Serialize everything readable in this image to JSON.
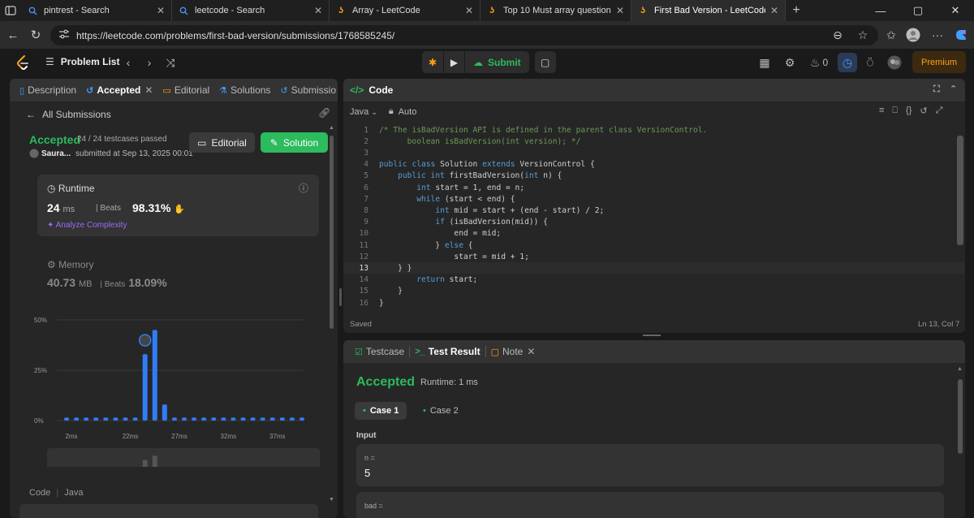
{
  "browser": {
    "tabs": [
      {
        "title": "pintrest - Search",
        "active": false
      },
      {
        "title": "leetcode - Search",
        "active": false
      },
      {
        "title": "Array - LeetCode",
        "active": false
      },
      {
        "title": "Top 10 Must array question for in",
        "active": false
      },
      {
        "title": "First Bad Version - LeetCode",
        "active": true
      }
    ],
    "url": "https://leetcode.com/problems/first-bad-version/submissions/1768585245/"
  },
  "header": {
    "problem_list": "Problem List",
    "submit": "Submit",
    "streak_count": "0",
    "premium": "Premium"
  },
  "left_panel": {
    "tabs": [
      "Description",
      "Accepted",
      "Editorial",
      "Solutions",
      "Submissio"
    ],
    "all_submissions": "All Submissions",
    "status": "Accepted",
    "passed": "24 / 24 testcases passed",
    "user": "Saura...",
    "submitted": "submitted at Sep 13, 2025 00:01",
    "editorial_btn": "Editorial",
    "solution_btn": "Solution",
    "runtime": {
      "label": "Runtime",
      "value": "24",
      "unit": "ms",
      "beats_label": "Beats",
      "beats": "98.31%",
      "analyze": "Analyze Complexity"
    },
    "memory": {
      "label": "Memory",
      "value": "40.73",
      "unit": "MB",
      "beats_label": "Beats",
      "beats": "18.09%"
    },
    "code_label": "Code",
    "code_lang": "Java"
  },
  "chart_data": {
    "type": "bar",
    "y_ticks": [
      "50%",
      "25%",
      "0%"
    ],
    "ylim": [
      0,
      50
    ],
    "x_ticks": [
      "2ms",
      "22ms",
      "27ms",
      "32ms",
      "37ms"
    ],
    "values": [
      1.5,
      1.5,
      1.5,
      1.5,
      1.5,
      1.5,
      1.5,
      1.5,
      33,
      45,
      8,
      1.5,
      1.5,
      1.5,
      1.5,
      1.5,
      1.5,
      1.5,
      1.5,
      1.5,
      1.5,
      1.5,
      1.5,
      1.5,
      1.5
    ],
    "mini_x_ticks": [
      "2ms",
      "22ms",
      "27ms",
      "32ms",
      "37ms"
    ],
    "highlight_index": 8
  },
  "code_panel": {
    "title": "Code",
    "language": "Java",
    "mode": "Auto",
    "lines": [
      "/* The isBadVersion API is defined in the parent class VersionControl.",
      "      boolean isBadVersion(int version); */",
      "",
      "public class Solution extends VersionControl {",
      "    public int firstBadVersion(int n) {",
      "        int start = 1, end = n;",
      "        while (start < end) {",
      "            int mid = start + (end - start) / 2;",
      "            if (isBadVersion(mid)) {",
      "                end = mid;",
      "            } else {",
      "                start = mid + 1;",
      "    } }",
      "        return start;",
      "    }",
      "}"
    ],
    "saved": "Saved",
    "cursor": "Ln 13, Col 7"
  },
  "test_panel": {
    "tabs": [
      "Testcase",
      "Test Result",
      "Note"
    ],
    "status": "Accepted",
    "runtime": "Runtime: 1 ms",
    "cases": [
      "Case 1",
      "Case 2"
    ],
    "input_label": "Input",
    "inputs": [
      {
        "name": "n =",
        "value": "5"
      },
      {
        "name": "bad =",
        "value": ""
      }
    ]
  }
}
